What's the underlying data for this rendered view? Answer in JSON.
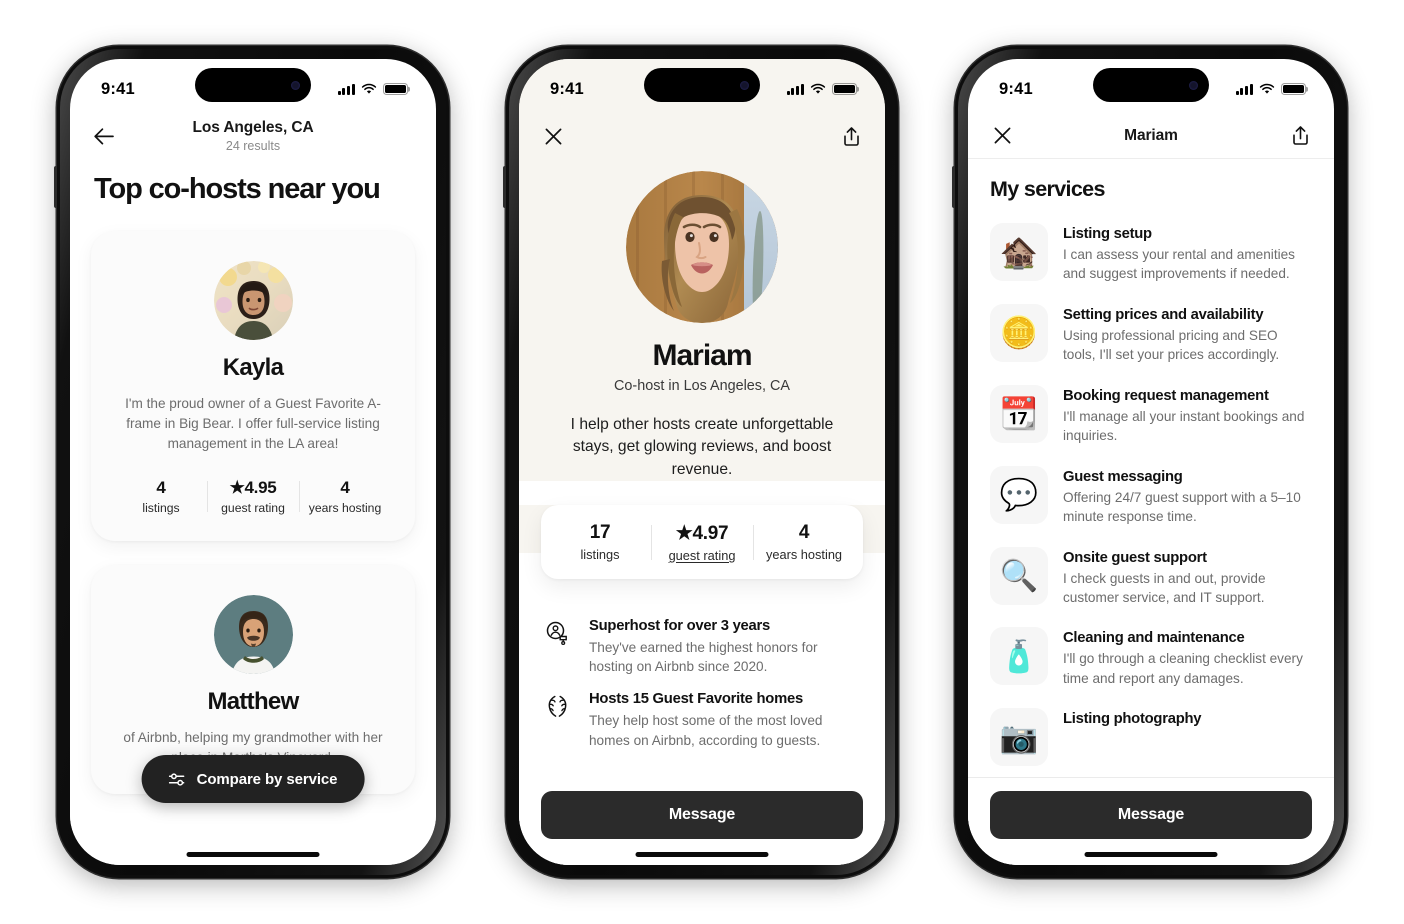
{
  "status_bar": {
    "time": "9:41",
    "signal_icon": "cellular-bars-icon",
    "wifi_icon": "wifi-icon",
    "battery_icon": "battery-icon"
  },
  "phone1": {
    "nav": {
      "back_icon": "arrow-left-icon",
      "title": "Los Angeles, CA",
      "subtitle": "24 results"
    },
    "heading": "Top co-hosts near you",
    "cards": [
      {
        "name": "Kayla",
        "bio": "I'm the proud owner of a Guest Favorite A-frame in Big Bear. I offer full-service listing management in the LA area!",
        "stats": [
          {
            "value": "4",
            "label": "listings"
          },
          {
            "value": "★4.95",
            "label": "guest rating"
          },
          {
            "value": "4",
            "label": "years hosting"
          }
        ]
      },
      {
        "name": "Matthew",
        "bio": "of Airbnb, helping my grandmother with her place in Martha's Vineyard."
      }
    ],
    "fab": {
      "icon": "tune-sliders-icon",
      "label": "Compare by service"
    }
  },
  "phone2": {
    "nav": {
      "close_icon": "close-x-icon",
      "share_icon": "share-upload-icon"
    },
    "name": "Mariam",
    "subtitle": "Co-host in Los Angeles, CA",
    "bio": "I help other hosts create unforgettable stays, get glowing reviews, and boost revenue.",
    "stats": [
      {
        "value": "17",
        "label": "listings",
        "underline": false
      },
      {
        "value": "★4.97",
        "label": "guest rating",
        "underline": true
      },
      {
        "value": "4",
        "label": "years hosting",
        "underline": false
      }
    ],
    "badges": [
      {
        "icon": "superhost-badge-icon",
        "title": "Superhost for over 3 years",
        "desc": "They've earned the highest honors for hosting on Airbnb since 2020."
      },
      {
        "icon": "guest-favorite-laurel-icon",
        "title": "Hosts 15 Guest Favorite homes",
        "desc": "They help host some of the most loved homes on Airbnb, according to guests."
      }
    ],
    "cta": "Message",
    "bg_color": "#f7f5f0"
  },
  "phone3": {
    "nav": {
      "close_icon": "close-x-icon",
      "title": "Mariam",
      "share_icon": "share-upload-icon"
    },
    "heading": "My services",
    "services": [
      {
        "icon": "house-icon",
        "emoji": "🏚️",
        "title": "Listing setup",
        "desc": "I can assess your rental and amenities and suggest improvements if needed."
      },
      {
        "icon": "coin-icon",
        "emoji": "🪙",
        "title": "Setting prices and availability",
        "desc": "Using professional pricing and SEO tools, I'll set your prices accordingly."
      },
      {
        "icon": "calendar-icon",
        "emoji": "📆",
        "title": "Booking request management",
        "desc": "I'll manage all your instant bookings and inquiries."
      },
      {
        "icon": "speech-bubbles-icon",
        "emoji": "💬",
        "title": "Guest messaging",
        "desc": "Offering 24/7 guest support with a 5–10 minute response time."
      },
      {
        "icon": "magnifying-key-icon",
        "emoji": "🔍",
        "title": "Onsite guest support",
        "desc": "I check guests in and out, provide customer service, and IT support."
      },
      {
        "icon": "spray-bottle-icon",
        "emoji": "🧴",
        "title": "Cleaning and maintenance",
        "desc": "I'll go through a cleaning checklist every time and report any damages."
      },
      {
        "icon": "camera-icon",
        "emoji": "📷",
        "title": "Listing photography",
        "desc": ""
      }
    ],
    "cta": "Message"
  }
}
